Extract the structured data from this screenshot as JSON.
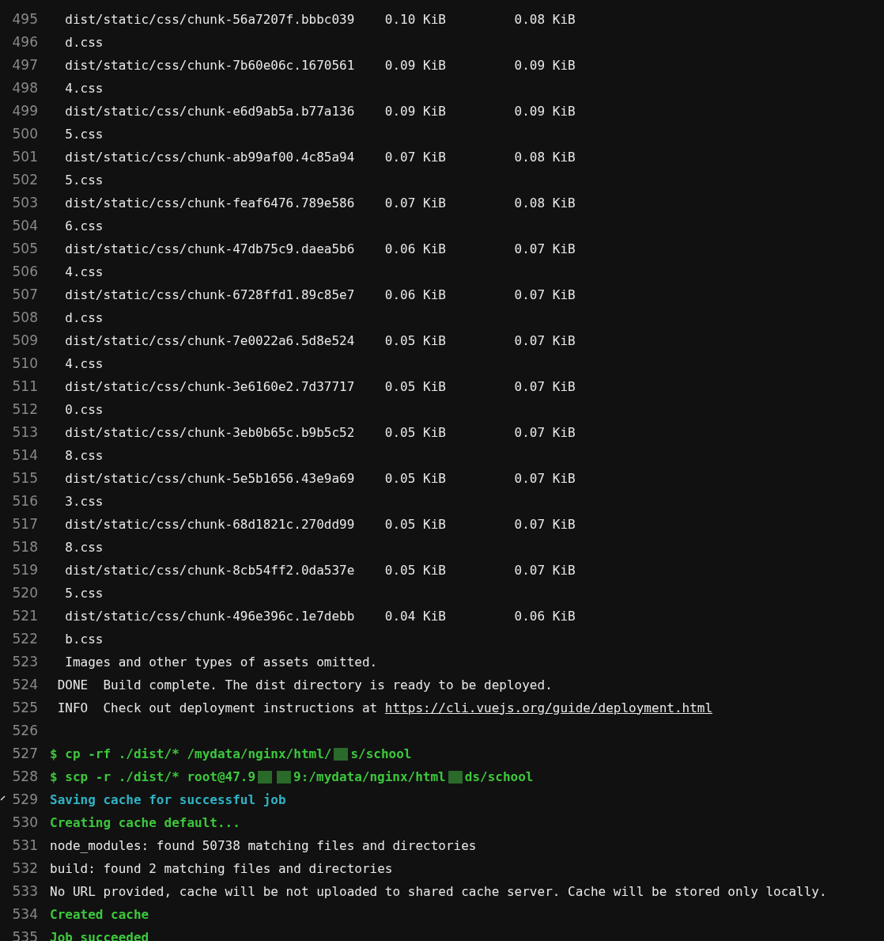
{
  "log_lines": [
    {
      "number": "495",
      "kind": "plain",
      "segments": [
        {
          "kind": "text",
          "text": "  dist/static/css/chunk-56a7207f.bbbc039    0.10 KiB         0.08 KiB"
        }
      ]
    },
    {
      "number": "496",
      "kind": "plain",
      "segments": [
        {
          "kind": "text",
          "text": "  d.css"
        }
      ]
    },
    {
      "number": "497",
      "kind": "plain",
      "segments": [
        {
          "kind": "text",
          "text": "  dist/static/css/chunk-7b60e06c.1670561    0.09 KiB         0.09 KiB"
        }
      ]
    },
    {
      "number": "498",
      "kind": "plain",
      "segments": [
        {
          "kind": "text",
          "text": "  4.css"
        }
      ]
    },
    {
      "number": "499",
      "kind": "plain",
      "segments": [
        {
          "kind": "text",
          "text": "  dist/static/css/chunk-e6d9ab5a.b77a136    0.09 KiB         0.09 KiB"
        }
      ]
    },
    {
      "number": "500",
      "kind": "plain",
      "segments": [
        {
          "kind": "text",
          "text": "  5.css"
        }
      ]
    },
    {
      "number": "501",
      "kind": "plain",
      "segments": [
        {
          "kind": "text",
          "text": "  dist/static/css/chunk-ab99af00.4c85a94    0.07 KiB         0.08 KiB"
        }
      ]
    },
    {
      "number": "502",
      "kind": "plain",
      "segments": [
        {
          "kind": "text",
          "text": "  5.css"
        }
      ]
    },
    {
      "number": "503",
      "kind": "plain",
      "segments": [
        {
          "kind": "text",
          "text": "  dist/static/css/chunk-feaf6476.789e586    0.07 KiB         0.08 KiB"
        }
      ]
    },
    {
      "number": "504",
      "kind": "plain",
      "segments": [
        {
          "kind": "text",
          "text": "  6.css"
        }
      ]
    },
    {
      "number": "505",
      "kind": "plain",
      "segments": [
        {
          "kind": "text",
          "text": "  dist/static/css/chunk-47db75c9.daea5b6    0.06 KiB         0.07 KiB"
        }
      ]
    },
    {
      "number": "506",
      "kind": "plain",
      "segments": [
        {
          "kind": "text",
          "text": "  4.css"
        }
      ]
    },
    {
      "number": "507",
      "kind": "plain",
      "segments": [
        {
          "kind": "text",
          "text": "  dist/static/css/chunk-6728ffd1.89c85e7    0.06 KiB         0.07 KiB"
        }
      ]
    },
    {
      "number": "508",
      "kind": "plain",
      "segments": [
        {
          "kind": "text",
          "text": "  d.css"
        }
      ]
    },
    {
      "number": "509",
      "kind": "plain",
      "segments": [
        {
          "kind": "text",
          "text": "  dist/static/css/chunk-7e0022a6.5d8e524    0.05 KiB         0.07 KiB"
        }
      ]
    },
    {
      "number": "510",
      "kind": "plain",
      "segments": [
        {
          "kind": "text",
          "text": "  4.css"
        }
      ]
    },
    {
      "number": "511",
      "kind": "plain",
      "segments": [
        {
          "kind": "text",
          "text": "  dist/static/css/chunk-3e6160e2.7d37717    0.05 KiB         0.07 KiB"
        }
      ]
    },
    {
      "number": "512",
      "kind": "plain",
      "segments": [
        {
          "kind": "text",
          "text": "  0.css"
        }
      ]
    },
    {
      "number": "513",
      "kind": "plain",
      "segments": [
        {
          "kind": "text",
          "text": "  dist/static/css/chunk-3eb0b65c.b9b5c52    0.05 KiB         0.07 KiB"
        }
      ]
    },
    {
      "number": "514",
      "kind": "plain",
      "segments": [
        {
          "kind": "text",
          "text": "  8.css"
        }
      ]
    },
    {
      "number": "515",
      "kind": "plain",
      "segments": [
        {
          "kind": "text",
          "text": "  dist/static/css/chunk-5e5b1656.43e9a69    0.05 KiB         0.07 KiB"
        }
      ]
    },
    {
      "number": "516",
      "kind": "plain",
      "segments": [
        {
          "kind": "text",
          "text": "  3.css"
        }
      ]
    },
    {
      "number": "517",
      "kind": "plain",
      "segments": [
        {
          "kind": "text",
          "text": "  dist/static/css/chunk-68d1821c.270dd99    0.05 KiB         0.07 KiB"
        }
      ]
    },
    {
      "number": "518",
      "kind": "plain",
      "segments": [
        {
          "kind": "text",
          "text": "  8.css"
        }
      ]
    },
    {
      "number": "519",
      "kind": "plain",
      "segments": [
        {
          "kind": "text",
          "text": "  dist/static/css/chunk-8cb54ff2.0da537e    0.05 KiB         0.07 KiB"
        }
      ]
    },
    {
      "number": "520",
      "kind": "plain",
      "segments": [
        {
          "kind": "text",
          "text": "  5.css"
        }
      ]
    },
    {
      "number": "521",
      "kind": "plain",
      "segments": [
        {
          "kind": "text",
          "text": "  dist/static/css/chunk-496e396c.1e7debb    0.04 KiB         0.06 KiB"
        }
      ]
    },
    {
      "number": "522",
      "kind": "plain",
      "segments": [
        {
          "kind": "text",
          "text": "  b.css"
        }
      ]
    },
    {
      "number": "523",
      "kind": "plain",
      "segments": [
        {
          "kind": "text",
          "text": "  Images and other types of assets omitted."
        }
      ]
    },
    {
      "number": "524",
      "kind": "plain",
      "segments": [
        {
          "kind": "text",
          "text": " DONE  Build complete. The dist directory is ready to be deployed."
        }
      ]
    },
    {
      "number": "525",
      "kind": "plain",
      "segments": [
        {
          "kind": "text",
          "text": " INFO  Check out deployment instructions at "
        },
        {
          "kind": "link",
          "text": "https://cli.vuejs.org/guide/deployment.html"
        }
      ]
    },
    {
      "number": "526"
    },
    {
      "number": "527",
      "kind": "green",
      "segments": [
        {
          "kind": "text",
          "text": "$ cp -rf ./dist/* /mydata/nginx/html/"
        },
        {
          "kind": "redacted"
        },
        {
          "kind": "text",
          "text": "s/school"
        }
      ]
    },
    {
      "number": "528",
      "kind": "green",
      "segments": [
        {
          "kind": "text",
          "text": "$ scp -r ./dist/* root@47.9"
        },
        {
          "kind": "redacted"
        },
        {
          "kind": "redacted"
        },
        {
          "kind": "text",
          "text": "9:/mydata/nginx/html"
        },
        {
          "kind": "redacted"
        },
        {
          "kind": "text",
          "text": "ds/school"
        }
      ]
    },
    {
      "number": "529",
      "kind": "cyan",
      "collapsible": true,
      "segments": [
        {
          "kind": "text",
          "text": "Saving cache for successful job"
        }
      ]
    },
    {
      "number": "530",
      "kind": "green",
      "segments": [
        {
          "kind": "text",
          "text": "Creating cache default..."
        }
      ]
    },
    {
      "number": "531",
      "kind": "plain",
      "segments": [
        {
          "kind": "text",
          "text": "node_modules: found 50738 matching files and directories"
        }
      ]
    },
    {
      "number": "532",
      "kind": "plain",
      "segments": [
        {
          "kind": "text",
          "text": "build: found 2 matching files and directories"
        }
      ]
    },
    {
      "number": "533",
      "kind": "plain",
      "segments": [
        {
          "kind": "text",
          "text": "No URL provided, cache will be not uploaded to shared cache server. Cache will be stored only locally."
        }
      ]
    },
    {
      "number": "534",
      "kind": "green",
      "segments": [
        {
          "kind": "text",
          "text": "Created cache"
        }
      ]
    },
    {
      "number": "535",
      "kind": "green",
      "segments": [
        {
          "kind": "text",
          "text": "Job succeeded"
        }
      ]
    }
  ]
}
